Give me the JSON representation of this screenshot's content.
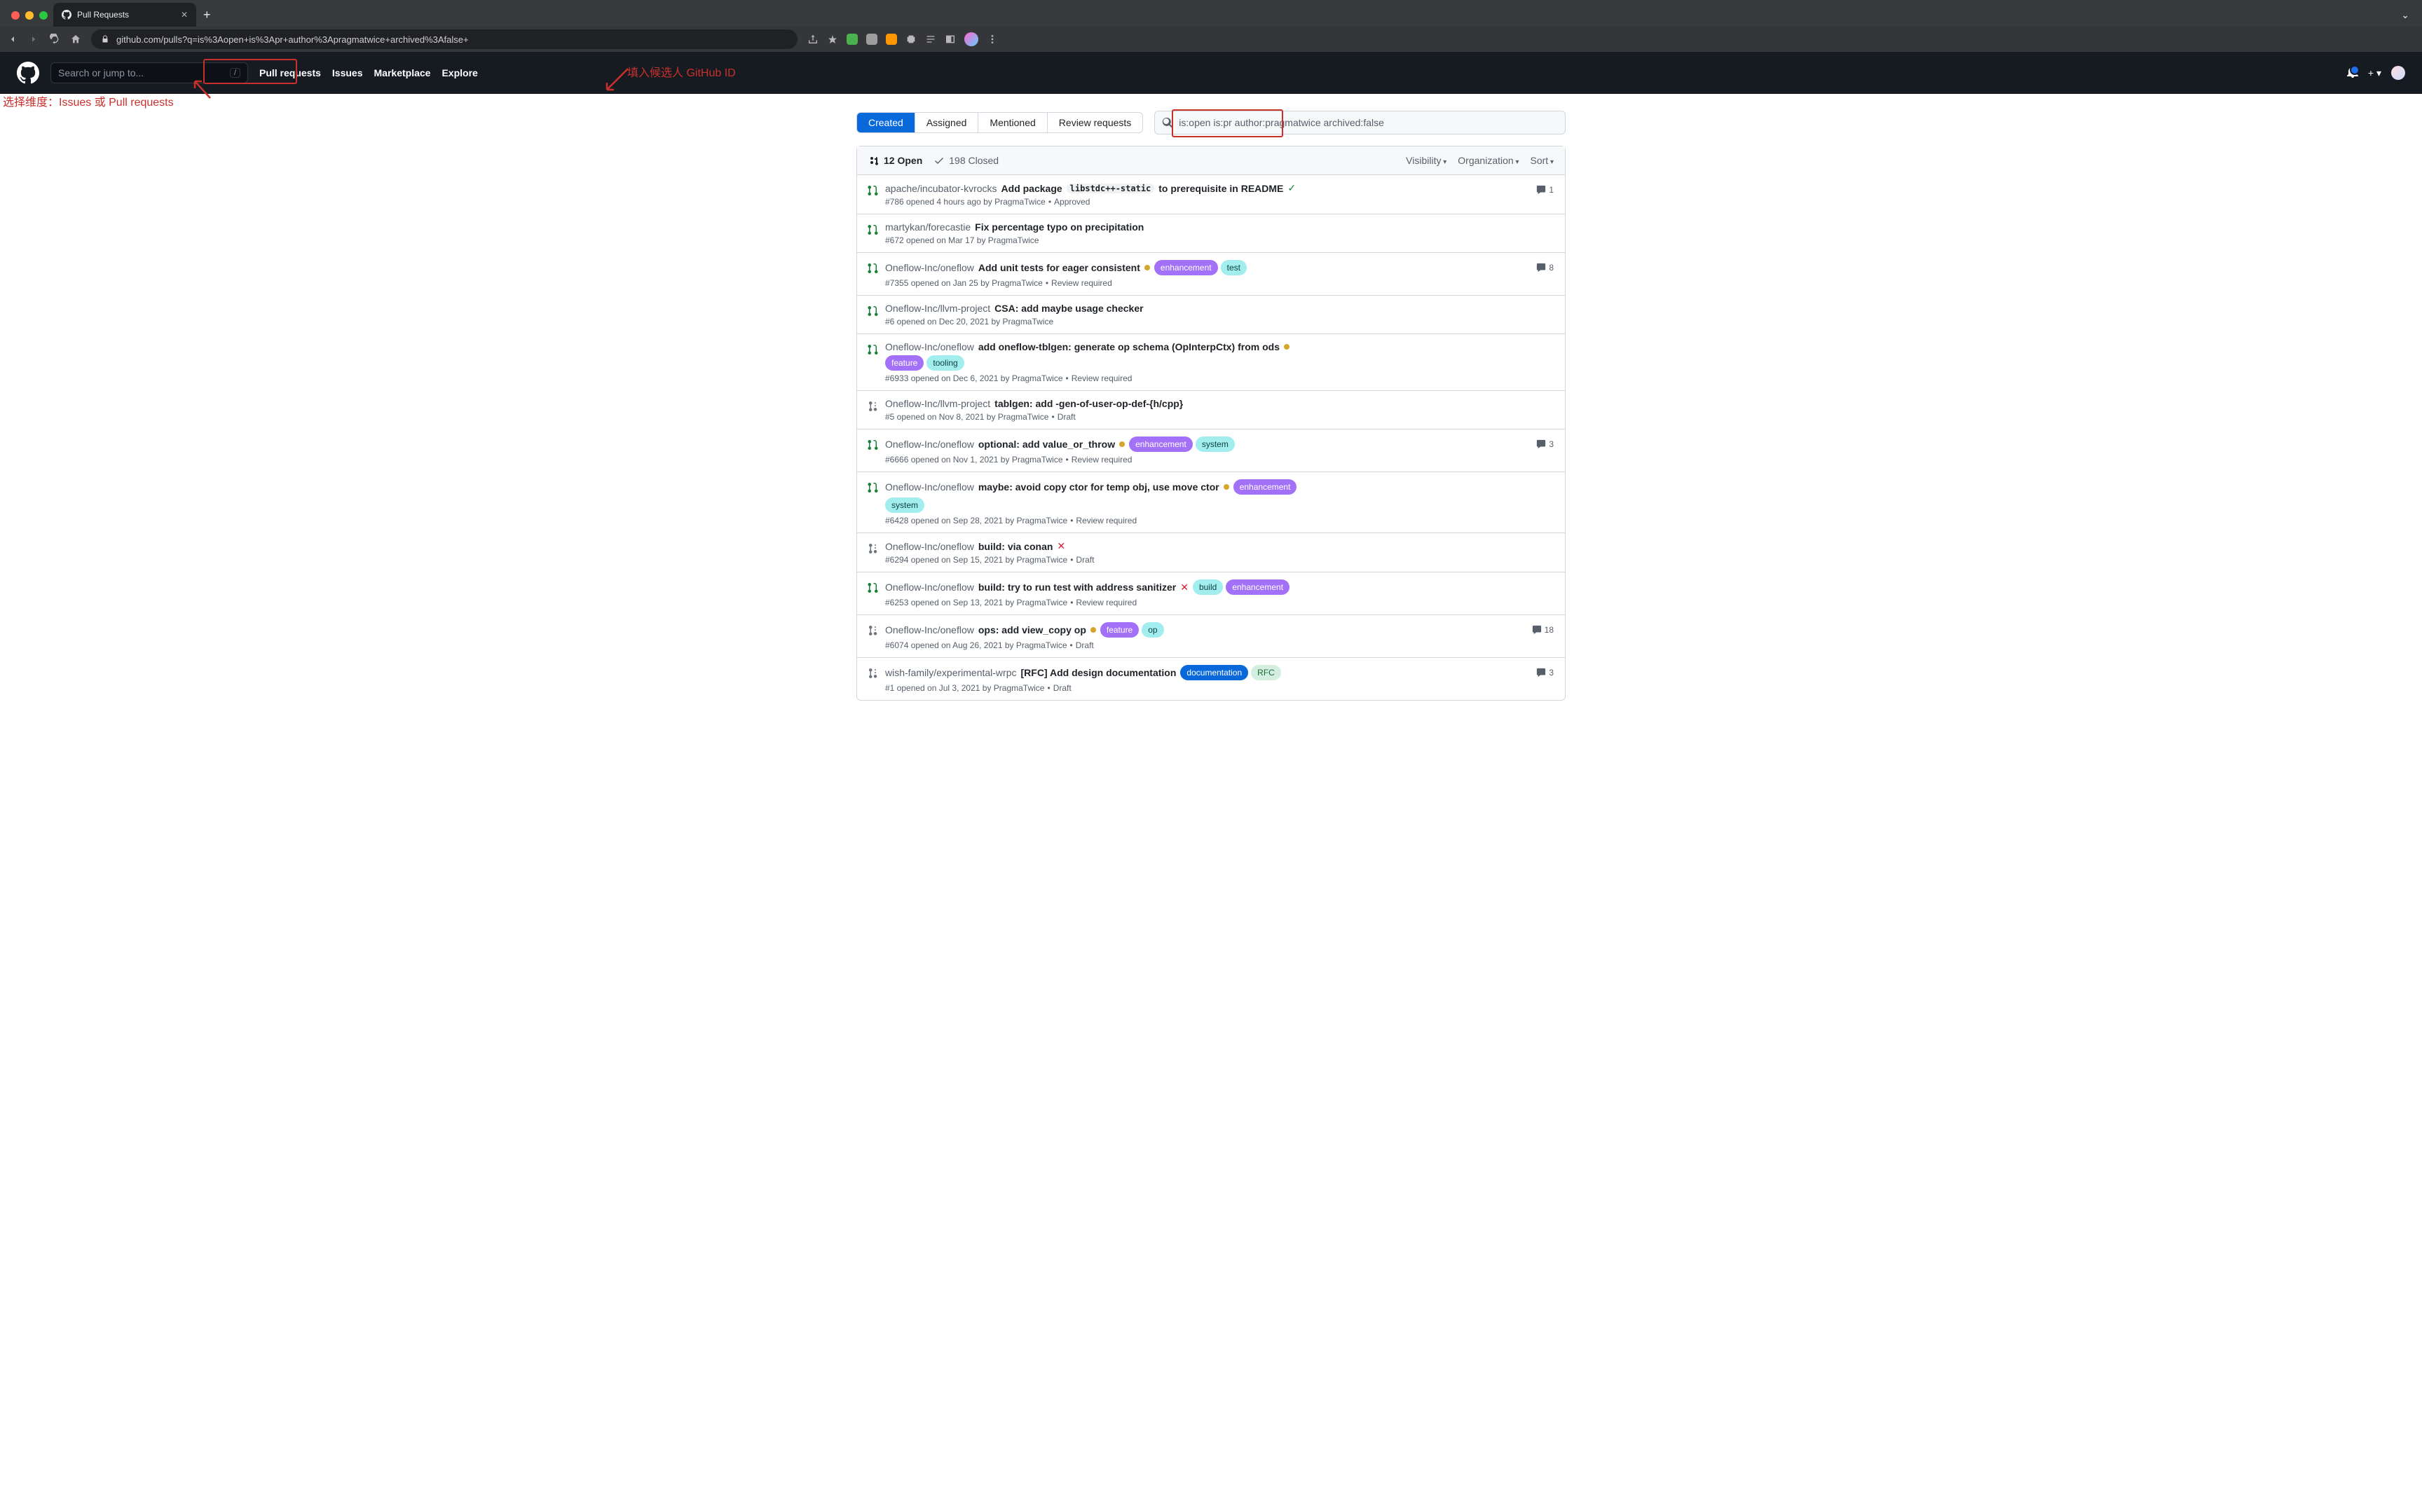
{
  "browser": {
    "tab_title": "Pull Requests",
    "url": "github.com/pulls?q=is%3Aopen+is%3Apr+author%3Apragmatwice+archived%3Afalse+"
  },
  "header": {
    "search_placeholder": "Search or jump to...",
    "nav": {
      "pulls": "Pull requests",
      "issues": "Issues",
      "marketplace": "Marketplace",
      "explore": "Explore"
    }
  },
  "subnav": {
    "tabs": {
      "created": "Created",
      "assigned": "Assigned",
      "mentioned": "Mentioned",
      "review": "Review requests"
    },
    "query": "is:open is:pr author:pragmatwice archived:false"
  },
  "list_header": {
    "open": "12 Open",
    "closed": "198 Closed",
    "visibility": "Visibility",
    "organization": "Organization",
    "sort": "Sort"
  },
  "annotations": {
    "left": "选择维度：Issues 或 Pull requests",
    "right": "填入候选人 GitHub ID"
  },
  "rows": [
    {
      "type": "open",
      "repo": "apache/incubator-kvrocks",
      "title_pre": "Add package ",
      "code": "libstdc++-static",
      "title_post": " to prerequisite in README",
      "status": "check",
      "labels": [],
      "meta": "#786 opened 4 hours ago by PragmaTwice",
      "review": "Approved",
      "comments": 1
    },
    {
      "type": "open",
      "repo": "martykan/forecastie",
      "title": "Fix percentage typo on precipitation",
      "labels": [],
      "meta": "#672 opened on Mar 17 by PragmaTwice"
    },
    {
      "type": "open",
      "repo": "Oneflow-Inc/oneflow",
      "title": "Add unit tests for eager consistent",
      "status": "dot",
      "labels": [
        {
          "cls": "l-enh",
          "text": "enhancement"
        },
        {
          "cls": "l-test",
          "text": "test"
        }
      ],
      "meta": "#7355 opened on Jan 25 by PragmaTwice",
      "review": "Review required",
      "comments": 8
    },
    {
      "type": "open",
      "repo": "Oneflow-Inc/llvm-project",
      "title": "CSA: add maybe usage checker",
      "labels": [],
      "meta": "#6 opened on Dec 20, 2021 by PragmaTwice"
    },
    {
      "type": "open",
      "repo": "Oneflow-Inc/oneflow",
      "title": "add oneflow-tblgen: generate op schema (OpInterpCtx) from ods",
      "status": "dot",
      "labels_below": [
        {
          "cls": "l-feature",
          "text": "feature"
        },
        {
          "cls": "l-tooling",
          "text": "tooling"
        }
      ],
      "meta": "#6933 opened on Dec 6, 2021 by PragmaTwice",
      "review": "Review required"
    },
    {
      "type": "draft",
      "repo": "Oneflow-Inc/llvm-project",
      "title": "tablgen: add -gen-of-user-op-def-{h/cpp}",
      "labels": [],
      "meta": "#5 opened on Nov 8, 2021 by PragmaTwice",
      "review": "Draft"
    },
    {
      "type": "open",
      "repo": "Oneflow-Inc/oneflow",
      "title": "optional: add value_or_throw",
      "status": "dot",
      "labels": [
        {
          "cls": "l-enh",
          "text": "enhancement"
        },
        {
          "cls": "l-system",
          "text": "system"
        }
      ],
      "meta": "#6666 opened on Nov 1, 2021 by PragmaTwice",
      "review": "Review required",
      "comments": 3
    },
    {
      "type": "open",
      "repo": "Oneflow-Inc/oneflow",
      "title": "maybe: avoid copy ctor for temp obj, use move ctor",
      "status": "dot",
      "labels": [
        {
          "cls": "l-enh",
          "text": "enhancement"
        }
      ],
      "labels_below": [
        {
          "cls": "l-system",
          "text": "system"
        }
      ],
      "meta": "#6428 opened on Sep 28, 2021 by PragmaTwice",
      "review": "Review required"
    },
    {
      "type": "draft",
      "repo": "Oneflow-Inc/oneflow",
      "title": "build: via conan",
      "status": "cross",
      "labels": [],
      "meta": "#6294 opened on Sep 15, 2021 by PragmaTwice",
      "review": "Draft"
    },
    {
      "type": "open",
      "repo": "Oneflow-Inc/oneflow",
      "title": "build: try to run test with address sanitizer",
      "status": "cross",
      "labels": [
        {
          "cls": "l-build",
          "text": "build"
        },
        {
          "cls": "l-enh",
          "text": "enhancement"
        }
      ],
      "meta": "#6253 opened on Sep 13, 2021 by PragmaTwice",
      "review": "Review required"
    },
    {
      "type": "draft",
      "repo": "Oneflow-Inc/oneflow",
      "title": "ops: add view_copy op",
      "status": "dot",
      "labels": [
        {
          "cls": "l-feature",
          "text": "feature"
        },
        {
          "cls": "l-op",
          "text": "op"
        }
      ],
      "meta": "#6074 opened on Aug 26, 2021 by PragmaTwice",
      "review": "Draft",
      "comments": 18
    },
    {
      "type": "draft",
      "repo": "wish-family/experimental-wrpc",
      "title": "[RFC] Add design documentation",
      "labels": [
        {
          "cls": "l-doc",
          "text": "documentation"
        },
        {
          "cls": "l-rfc",
          "text": "RFC"
        }
      ],
      "meta": "#1 opened on Jul 3, 2021 by PragmaTwice",
      "review": "Draft",
      "comments": 3
    }
  ]
}
